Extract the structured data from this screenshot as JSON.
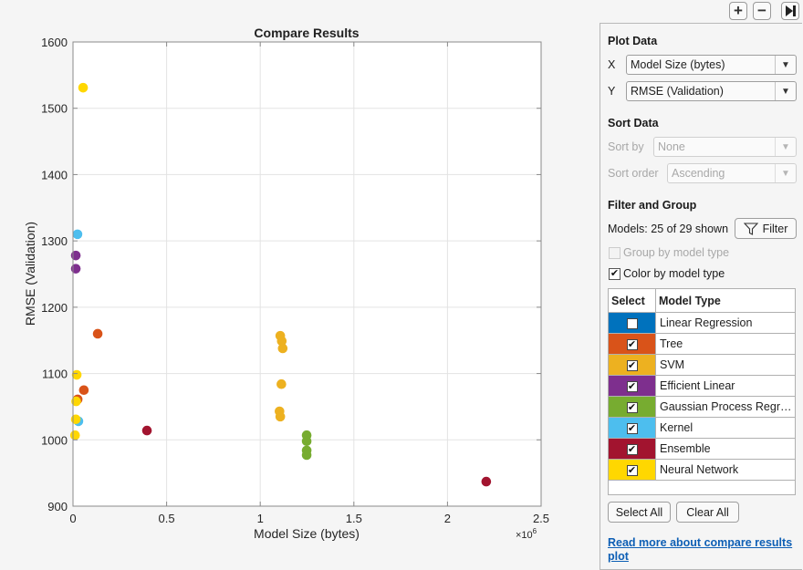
{
  "toolbar": {
    "zoom_in_icon": "+",
    "zoom_out_icon": "−",
    "collapse_icon": "▶|"
  },
  "chart_data": {
    "type": "scatter",
    "title": "Compare Results",
    "xlabel": "Model Size (bytes)",
    "ylabel": "RMSE (Validation)",
    "x_exponent_label": "×10",
    "x_exponent": "6",
    "xlim": [
      0,
      2500000
    ],
    "ylim": [
      900,
      1600
    ],
    "xticks": [
      0,
      500000,
      1000000,
      1500000,
      2000000,
      2500000
    ],
    "xtick_labels": [
      "0",
      "0.5",
      "1",
      "1.5",
      "2",
      "2.5"
    ],
    "yticks": [
      900,
      1000,
      1100,
      1200,
      1300,
      1400,
      1500,
      1600
    ],
    "ytick_labels": [
      "900",
      "1000",
      "1100",
      "1200",
      "1300",
      "1400",
      "1500",
      "1600"
    ],
    "grid": true,
    "series": [
      {
        "name": "Tree",
        "color": "#d95319",
        "points": [
          [
            132000,
            1160
          ],
          [
            58000,
            1075
          ],
          [
            25000,
            1061
          ]
        ]
      },
      {
        "name": "SVM",
        "color": "#edb120",
        "points": [
          [
            1107000,
            1157
          ],
          [
            1115000,
            1149
          ],
          [
            1120000,
            1138
          ],
          [
            1113000,
            1084
          ],
          [
            1103000,
            1043
          ],
          [
            1107000,
            1035
          ]
        ]
      },
      {
        "name": "Efficient Linear",
        "color": "#7e2f8e",
        "points": [
          [
            15000,
            1278
          ],
          [
            15000,
            1258
          ]
        ]
      },
      {
        "name": "Gaussian Process Regression",
        "color": "#77ac30",
        "points": [
          [
            1248000,
            1007
          ],
          [
            1248000,
            998
          ],
          [
            1248000,
            984
          ],
          [
            1248000,
            977
          ]
        ]
      },
      {
        "name": "Kernel",
        "color": "#4dbeee",
        "points": [
          [
            24000,
            1310
          ],
          [
            29000,
            1028
          ]
        ]
      },
      {
        "name": "Ensemble",
        "color": "#a2142f",
        "points": [
          [
            395000,
            1014
          ],
          [
            2207000,
            937
          ]
        ]
      },
      {
        "name": "Neural Network",
        "color": "#ffd700",
        "points": [
          [
            54000,
            1531
          ],
          [
            20000,
            1098
          ],
          [
            17000,
            1058
          ],
          [
            15000,
            1031
          ],
          [
            11000,
            1007
          ]
        ]
      }
    ]
  },
  "panel": {
    "plot_data": {
      "title": "Plot Data",
      "x_label": "X",
      "x_value": "Model Size (bytes)",
      "y_label": "Y",
      "y_value": "RMSE (Validation)"
    },
    "sort_data": {
      "title": "Sort Data",
      "sort_by_label": "Sort by",
      "sort_by_value": "None",
      "sort_order_label": "Sort order",
      "sort_order_value": "Ascending"
    },
    "filter_group": {
      "title": "Filter and Group",
      "models_shown": "Models: 25 of 29 shown",
      "filter_button": "Filter",
      "group_by_label": "Group by model type",
      "group_by_checked": false,
      "color_by_label": "Color by model type",
      "color_by_checked": true
    },
    "table": {
      "headers": [
        "Select",
        "Model Type"
      ],
      "rows": [
        {
          "name": "Linear Regression",
          "color": "#0072bd",
          "checked": false
        },
        {
          "name": "Tree",
          "color": "#d95319",
          "checked": true
        },
        {
          "name": "SVM",
          "color": "#edb120",
          "checked": true
        },
        {
          "name": "Efficient Linear",
          "color": "#7e2f8e",
          "checked": true
        },
        {
          "name": "Gaussian Process Regre…",
          "color": "#77ac30",
          "checked": true
        },
        {
          "name": "Kernel",
          "color": "#4dbeee",
          "checked": true
        },
        {
          "name": "Ensemble",
          "color": "#a2142f",
          "checked": true
        },
        {
          "name": "Neural Network",
          "color": "#ffd700",
          "checked": true
        }
      ]
    },
    "select_all": "Select All",
    "clear_all": "Clear All",
    "help_link": "Read more about compare results plot"
  }
}
